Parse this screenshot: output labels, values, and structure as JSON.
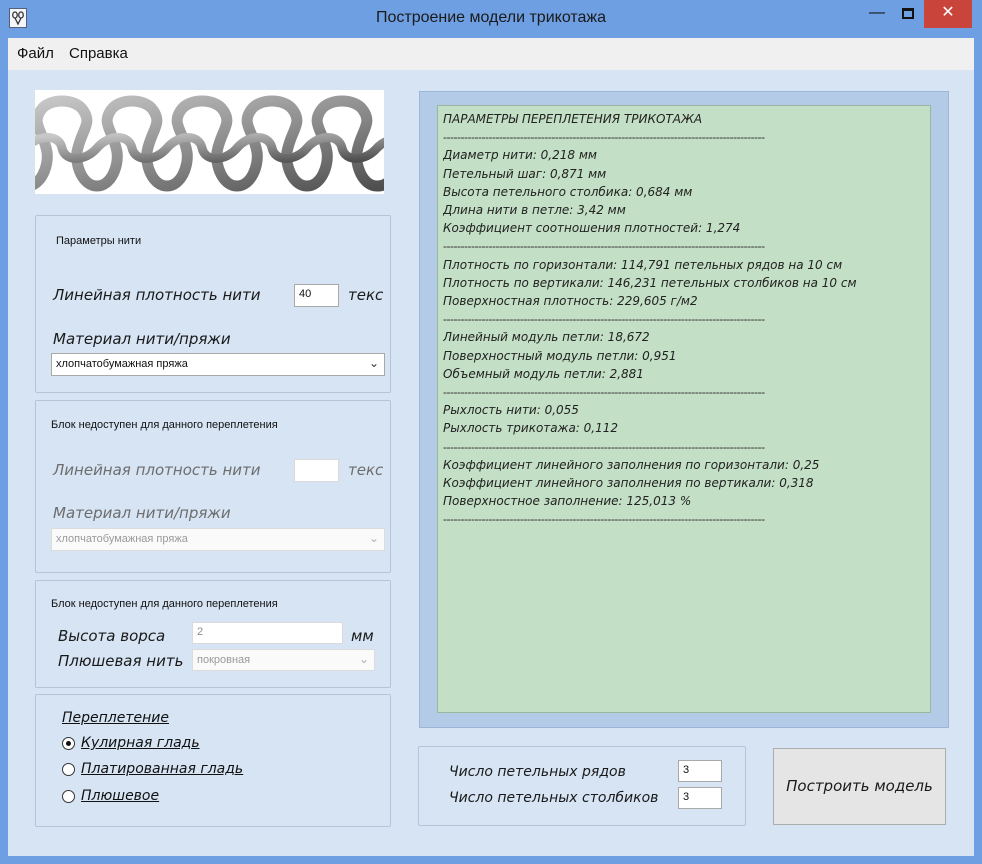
{
  "window": {
    "title": "Построение модели трикотажа",
    "minimize_glyph": "—",
    "close_glyph": "✕"
  },
  "menu": {
    "file": "Файл",
    "help": "Справка"
  },
  "thread_params": {
    "caption": "Параметры нити",
    "density_label": "Линейная плотность нити",
    "density_value": "40",
    "unit": "текс",
    "material_label": "Материал нити/пряжи",
    "material_value": "хлопчатобумажная пряжа"
  },
  "second_thread": {
    "caption": "Блок недоступен для данного переплетения",
    "density_label": "Линейная плотность нити",
    "density_value": "",
    "unit": "текс",
    "material_label": "Материал нити/пряжи",
    "material_value": "хлопчатобумажная пряжа"
  },
  "pile": {
    "caption": "Блок недоступен для данного переплетения",
    "height_label": "Высота ворса",
    "height_value": "2",
    "unit": "мм",
    "plush_label": "Плюшевая нить",
    "plush_value": "покровная"
  },
  "weave": {
    "title": "Переплетение",
    "options": [
      {
        "label": "Кулирная гладь",
        "selected": true
      },
      {
        "label": "Платированная гладь",
        "selected": false
      },
      {
        "label": "Плюшевое",
        "selected": false
      }
    ]
  },
  "counts": {
    "rows_label": "Число петельных рядов",
    "rows_value": "3",
    "cols_label": "Число петельных столбиков",
    "cols_value": "3"
  },
  "build_button": "Построить модель",
  "report": {
    "separator": "--------------------------------------------------------------------------------------------",
    "lines": [
      {
        "text": "ПАРАМЕТРЫ ПЕРЕПЛЕТЕНИЯ ТРИКОТАЖА"
      },
      {
        "sep": true
      },
      {
        "text": "Диаметр нити: 0,218 мм"
      },
      {
        "text": "Петельный шаг: 0,871 мм"
      },
      {
        "text": "Высота петельного столбика: 0,684 мм"
      },
      {
        "text": "Длина нити в петле: 3,42 мм"
      },
      {
        "text": "Коэффициент соотношения плотностей: 1,274"
      },
      {
        "sep": true
      },
      {
        "text": "Плотность по горизонтали: 114,791 петельных рядов на 10 см"
      },
      {
        "text": "Плотность по вертикали: 146,231 петельных столбиков на 10 см"
      },
      {
        "text": "Поверхностная плотность: 229,605 г/м2"
      },
      {
        "sep": true
      },
      {
        "text": "Линейный модуль петли: 18,672"
      },
      {
        "text": "Поверхностный модуль петли: 0,951"
      },
      {
        "text": "Объемный модуль петли: 2,881"
      },
      {
        "sep": true
      },
      {
        "text": "Рыхлость нити: 0,055"
      },
      {
        "text": "Рыхлость трикотажа: 0,112"
      },
      {
        "sep": true
      },
      {
        "text": "Коэффициент линейного заполнения по горизонтали: 0,25"
      },
      {
        "text": "Коэффициент линейного заполнения по вертикали: 0,318"
      },
      {
        "text": "Поверхностное заполнение: 125,013 %"
      },
      {
        "sep": true
      }
    ]
  },
  "icons": {
    "app": "app-icon",
    "dropdown": "chevron-down-icon",
    "logo": "knit-loops-image"
  },
  "colors": {
    "titlebar": "#6f9fe3",
    "client": "#d6e4f4",
    "report_bg": "#c3dfc5",
    "close_button": "#c9453b"
  }
}
